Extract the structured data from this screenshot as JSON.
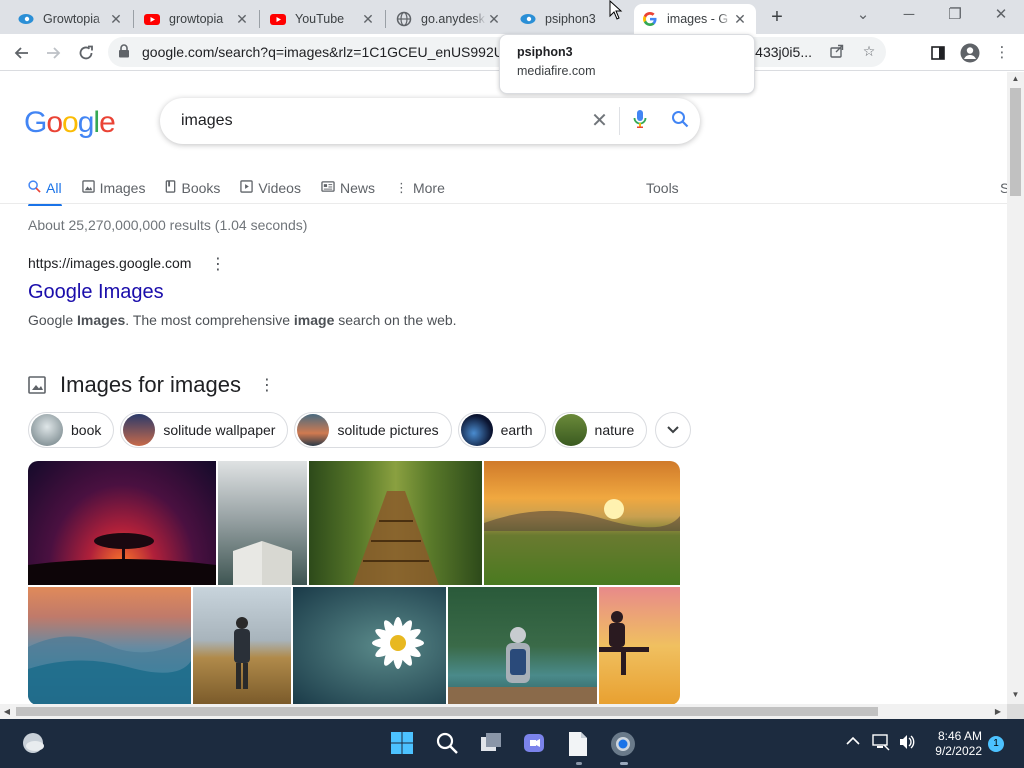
{
  "browser": {
    "tabs": [
      {
        "title": "Growtopia",
        "icon": "psiphon-icon",
        "active": false
      },
      {
        "title": "growtopia",
        "icon": "youtube-icon",
        "active": false
      },
      {
        "title": "YouTube",
        "icon": "youtube-icon",
        "active": false
      },
      {
        "title": "go.anydesk",
        "icon": "globe-icon",
        "active": false
      },
      {
        "title": "psiphon3",
        "icon": "psiphon-icon",
        "active": false
      },
      {
        "title": "images - G",
        "icon": "google-icon",
        "active": true
      }
    ],
    "url_left": "google.com/search?q=images&rlz=1C1GCEU_enUS992US",
    "url_right": "0i131i433j0i5...",
    "tooltip": {
      "title": "psiphon3",
      "domain": "mediafire.com"
    }
  },
  "search": {
    "logo": "Google",
    "query": "images",
    "nav_tabs": [
      {
        "label": "All",
        "icon": "search-icon",
        "active": true
      },
      {
        "label": "Images",
        "icon": "image-icon",
        "active": false
      },
      {
        "label": "Books",
        "icon": "book-icon",
        "active": false
      },
      {
        "label": "Videos",
        "icon": "play-icon",
        "active": false
      },
      {
        "label": "News",
        "icon": "news-icon",
        "active": false
      },
      {
        "label": "More",
        "icon": "more-vert-icon",
        "active": false
      }
    ],
    "tools_label": "Tools",
    "cut_label": "S",
    "stats": "About 25,270,000,000 results (1.04 seconds)",
    "result": {
      "url": "https://images.google.com",
      "title": "Google Images",
      "snippet_1": "Google ",
      "snippet_2": "Images",
      "snippet_3": ". The most comprehensive ",
      "snippet_4": "image",
      "snippet_5": " search on the web."
    },
    "images_heading": "Images for images",
    "chips": [
      "book",
      "solitude wallpaper",
      "solitude pictures",
      "earth",
      "nature"
    ]
  },
  "taskbar": {
    "time": "8:46 AM",
    "date": "9/2/2022",
    "notifications": "1"
  }
}
